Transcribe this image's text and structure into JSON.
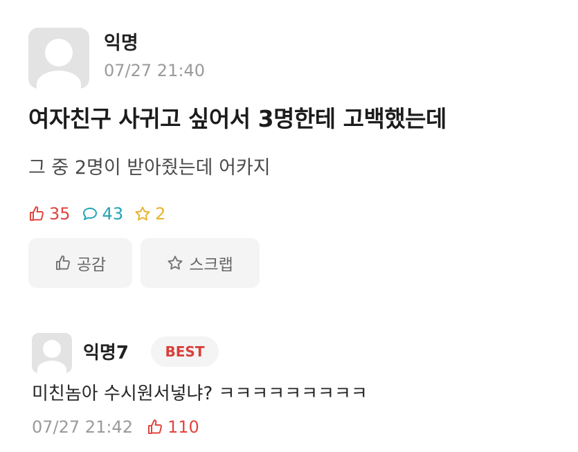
{
  "post": {
    "author": "익명",
    "date": "07/27 21:40",
    "title": "여자친구 사귀고 싶어서 3명한테 고백했는데",
    "body": "그 중 2명이 받아줬는데 어카지",
    "stats": {
      "likes": "35",
      "comments": "43",
      "scraps": "2"
    },
    "actions": {
      "like_label": "공감",
      "scrap_label": "스크랩"
    }
  },
  "comment": {
    "author": "익명7",
    "badge": "BEST",
    "text": "미친놈아 수시원서넣냐? ㅋㅋㅋㅋㅋㅋㅋㅋㅋ",
    "date": "07/27 21:42",
    "likes": "110"
  },
  "colors": {
    "like": "#e0453f",
    "comment": "#22a5b6",
    "scrap": "#e8b32a",
    "badge_text": "#d8403c",
    "muted": "#9a9a9a"
  },
  "icons": [
    "thumbs-up-icon",
    "speech-bubble-icon",
    "star-icon",
    "avatar-placeholder-icon"
  ]
}
